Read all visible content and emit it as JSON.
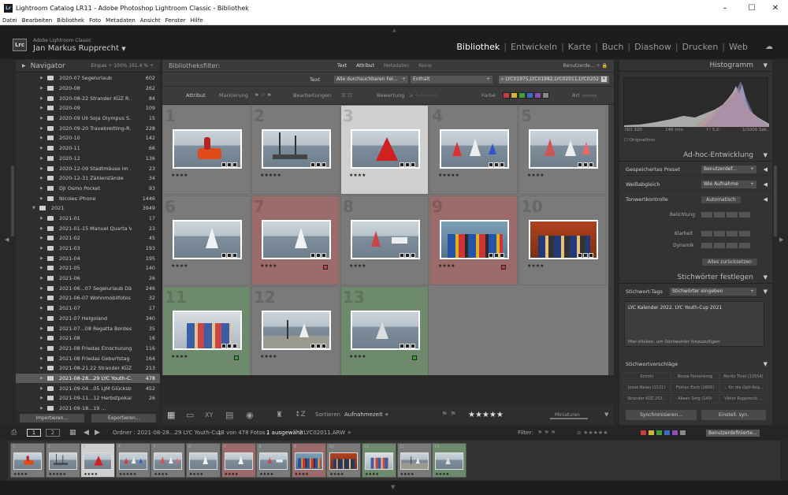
{
  "window": {
    "title": "Lightroom Catalog LR11 - Adobe Photoshop Lightroom Classic - Bibliothek"
  },
  "menu": [
    "Datei",
    "Bearbeiten",
    "Bibliothek",
    "Foto",
    "Metadaten",
    "Ansicht",
    "Fenster",
    "Hilfe"
  ],
  "identity": {
    "app": "Adobe Lightroom Classic",
    "user": "Jan Markus Rupprecht",
    "logo": "Lrc"
  },
  "modules": [
    "Bibliothek",
    "Entwickeln",
    "Karte",
    "Buch",
    "Diashow",
    "Drucken",
    "Web"
  ],
  "navigator": {
    "title": "Navigator",
    "opts": "Einpas ÷   100%   161.4 % ÷"
  },
  "folders": [
    {
      "name": "2020-07 Segelurlaub",
      "count": "602"
    },
    {
      "name": "2020-08",
      "count": "262"
    },
    {
      "name": "2020-08-22 Strander KÜZ R...",
      "count": "84"
    },
    {
      "name": "2020-09",
      "count": "109"
    },
    {
      "name": "2020-09 Uli Soja Olympus S...",
      "count": "15"
    },
    {
      "name": "2020-09-20 Travebreitling-R...",
      "count": "228"
    },
    {
      "name": "2020-10",
      "count": "142"
    },
    {
      "name": "2020-11",
      "count": "66"
    },
    {
      "name": "2020-12",
      "count": "136"
    },
    {
      "name": "2020-12-09 Stadtmäuse im ...",
      "count": "23"
    },
    {
      "name": "2020-12-31 Zählerstände",
      "count": "34"
    },
    {
      "name": "DJI Osmo Pocket",
      "count": "93"
    },
    {
      "name": "Nicoles iPhone",
      "count": "1446"
    },
    {
      "name": "2021",
      "count": "3949",
      "year": true
    },
    {
      "name": "2021-01",
      "count": "17"
    },
    {
      "name": "2021-01-15 Manuel Quarta V...",
      "count": "23"
    },
    {
      "name": "2021-02",
      "count": "45"
    },
    {
      "name": "2021-03",
      "count": "193"
    },
    {
      "name": "2021-04",
      "count": "195"
    },
    {
      "name": "2021-05",
      "count": "140"
    },
    {
      "name": "2021-06",
      "count": "26"
    },
    {
      "name": "2021-06...07 Segelurlaub Dän...",
      "count": "246"
    },
    {
      "name": "2021-06-07 Wohnmobilfotos",
      "count": "32"
    },
    {
      "name": "2021-07",
      "count": "17"
    },
    {
      "name": "2021-07 Helgoland",
      "count": "340"
    },
    {
      "name": "2021-07...08 Regatta Bordesh...",
      "count": "35"
    },
    {
      "name": "2021-08",
      "count": "16"
    },
    {
      "name": "2021-08 Friedas Einschulung",
      "count": "116"
    },
    {
      "name": "2021-08 Friedas Geburtstag",
      "count": "164"
    },
    {
      "name": "2021-08-21.22 Strander KÜZ...",
      "count": "213"
    },
    {
      "name": "2021-08-28...29 LYC Youth-C...",
      "count": "478",
      "selected": true
    },
    {
      "name": "2021-09-04...05 LJM Glücksb...",
      "count": "452"
    },
    {
      "name": "2021-09-11...12 Herbstpokal L...",
      "count": "26"
    },
    {
      "name": "2021-09-18...19 ...",
      "count": ""
    }
  ],
  "left_buttons": {
    "import": "Importieren...",
    "export": "Exportieren..."
  },
  "filter": {
    "label": "Bibliotheksfilter:",
    "tabs": [
      "Text",
      "Attribut",
      "Metadaten",
      "Keine"
    ],
    "preset": "Benutzerde... ÷",
    "text_label": "Text",
    "field1": "Alle durchsuchbaren Fel...",
    "field2": "Enthält",
    "search_value": "LYC01975,LYC01982,LYC02011,LYC0202",
    "attr_label": "Attribut",
    "markierung": "Markierung",
    "bearbeitungen": "Bearbeitungen",
    "bewertung": "Bewertung",
    "farbe": "Farbe",
    "art": "Art",
    "colors": [
      "#c74040",
      "#d4b437",
      "#3f9f3f",
      "#3d6ac7",
      "#8a4fb0",
      "#888888"
    ]
  },
  "photos": [
    {
      "idx": "1",
      "stars": "★★★★",
      "bg": "#7a7a7a",
      "scene": "boat"
    },
    {
      "idx": "2",
      "stars": "★★★★★",
      "bg": "#7a7a7a",
      "scene": "cat"
    },
    {
      "idx": "3",
      "stars": "★★★★",
      "bg": "#cfcfcf",
      "scene": "red",
      "selected": true
    },
    {
      "idx": "4",
      "stars": "★★★★★",
      "bg": "#7a7a7a",
      "scene": "fleet"
    },
    {
      "idx": "5",
      "stars": "★★★★",
      "bg": "#7a7a7a",
      "scene": "fleet2"
    },
    {
      "idx": "6",
      "stars": "★★★★",
      "bg": "#7a7a7a",
      "scene": "opti"
    },
    {
      "idx": "7",
      "stars": "★★★★",
      "bg": "#9b6a6a",
      "scene": "opti",
      "flag": "#c74040"
    },
    {
      "idx": "8",
      "stars": "★★★★",
      "bg": "#7a7a7a",
      "scene": "opti2"
    },
    {
      "idx": "9",
      "stars": "★★★★",
      "bg": "#9b6a6a",
      "scene": "kids",
      "flag": "#c74040"
    },
    {
      "idx": "10",
      "stars": "★★★★",
      "bg": "#7a7a7a",
      "scene": "kids2"
    },
    {
      "idx": "11",
      "stars": "★★★★",
      "bg": "#6d8a6d",
      "scene": "kids3",
      "flag": "#3f9f3f"
    },
    {
      "idx": "12",
      "stars": "★★★★",
      "bg": "#7a7a7a",
      "scene": "beach"
    },
    {
      "idx": "13",
      "stars": "★★★★",
      "bg": "#6d8a6d",
      "scene": "opti3",
      "flag": "#3f9f3f"
    }
  ],
  "toolbar": {
    "sort_label": "Sortieren",
    "sort_value": "Aufnahmezeit ÷",
    "stars": "★★★★★",
    "thumb_label": "Miniaturen"
  },
  "histogram": {
    "title": "Histogramm",
    "iso": "ISO 320",
    "focal": "146 mm",
    "aperture": "f / 5,0",
    "shutter": "1/1000 Sek.",
    "original": "Originalfoto"
  },
  "quick_develop": {
    "title": "Ad-hoc-Entwicklung",
    "preset_label": "Gespeichertes Preset",
    "preset_value": "Benutzerdef...",
    "wb_label": "Weißabgleich",
    "wb_value": "Wie Aufnahme",
    "tone_label": "Tonwertkontrolle",
    "tone_btn": "Automatisch",
    "exposure": "Belichtung",
    "clarity": "Klarheit",
    "vibrance": "Dynamik",
    "reset": "Alles zurücksetzen"
  },
  "keywords": {
    "title": "Stichwörter festlegen",
    "tags_label": "Stichwort-Tags",
    "tags_value": "Stichwörter eingeben",
    "keywords_value": "LYC Kalender 2022, LYC Youth-Cup 2021",
    "hint": "Hier klicken, um Stichwörter hinzuzufügen",
    "suggest_title": "Stichwortvorschläge",
    "suggestions": [
      "Schimi",
      "Bosse Fahrenkrog",
      "Moritz Thiel (13554)",
      "Jonas Belau (1521)",
      "Florian Esch (1600)",
      "... für die Opti-Reg...",
      "Strander KÜZ 202...",
      "Aileen Sorg (140)",
      "Viktor Rupprecht ..."
    ]
  },
  "sync": {
    "sync": "Synchronisieren...",
    "settings": "Einstell. syn."
  },
  "statusbar": {
    "folder": "Ordner : 2021-08-28...29 LYC Youth-Cup",
    "count": "13 von 478 Fotos /",
    "selected": "1 ausgewählt",
    "file": "/ LYC02011.ARW ÷",
    "filter_label": "Filter:",
    "filter_preset": "Benutzerdefinierte..."
  }
}
